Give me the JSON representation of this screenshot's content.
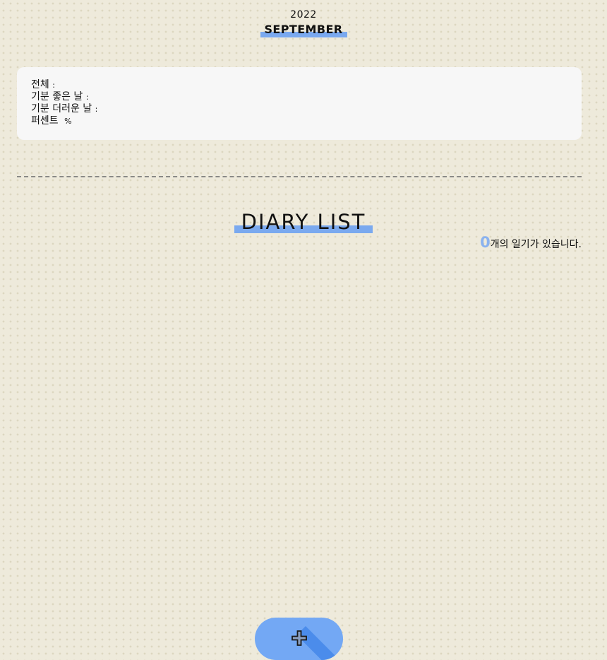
{
  "header": {
    "year": "2022",
    "month": "SEPTEMBER"
  },
  "stats": {
    "total_label": "전체",
    "good_days_label": "기분 좋은 날",
    "bad_days_label": "기분 더러운 날",
    "percent_label": "퍼센트",
    "separator": ":",
    "percent_unit": "%"
  },
  "diary_list": {
    "title": "DIARY LIST",
    "count": "0",
    "count_suffix": "개의 일기가 있습니다."
  },
  "add_button": {
    "icon": "plus-icon"
  },
  "colors": {
    "accent": "#7aa9ef",
    "button": "#73a8f4",
    "background": "#eeeadb",
    "card": "#f7f7f7"
  }
}
